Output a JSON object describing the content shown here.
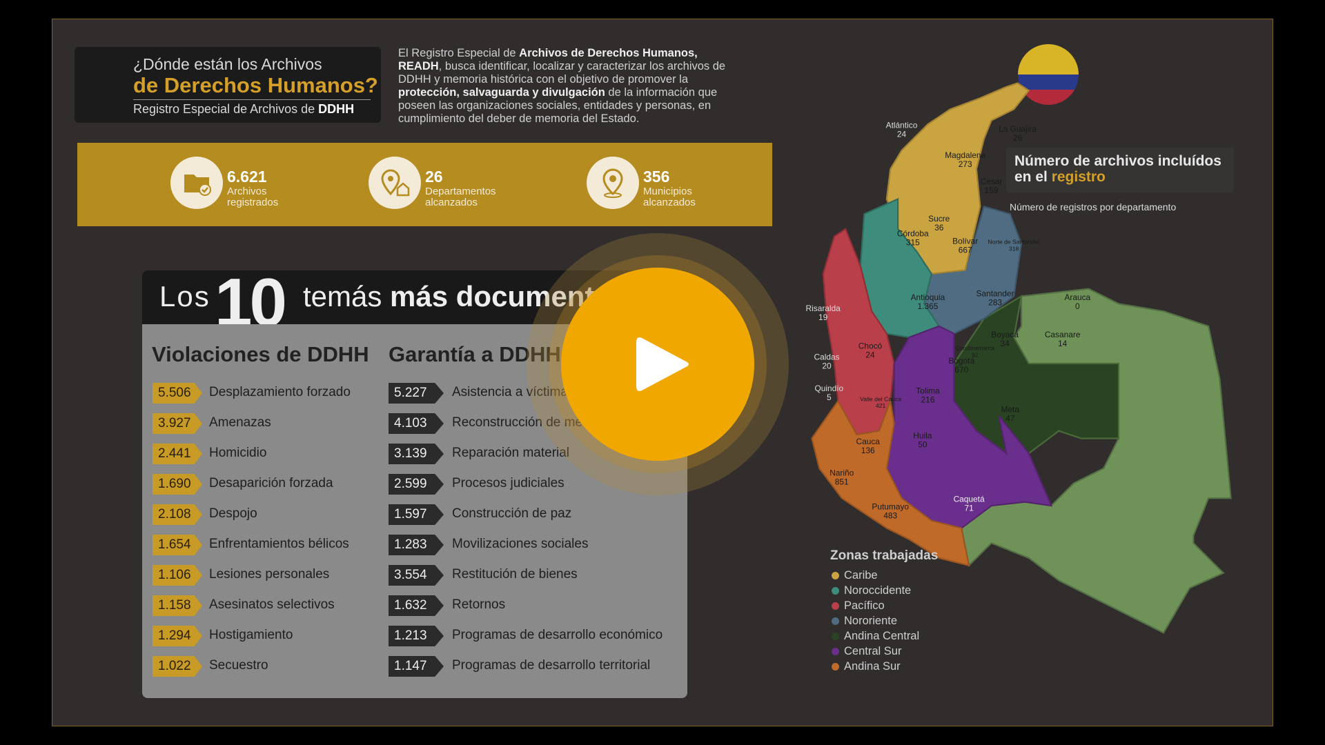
{
  "header": {
    "line1": "¿Dónde están los Archivos",
    "line2": "de Derechos Humanos?",
    "line3_prefix": "Registro Especial de Archivos de ",
    "line3_bold": "DDHH"
  },
  "intro": {
    "p1": "El Registro Especial de ",
    "b1": "Archivos de Derechos Humanos, READH",
    "p2": ", busca identificar, localizar y caracterizar los archivos de DDHH y memoria histórica con el objetivo de promover la ",
    "b2": "protección, salvaguarda y divulgación",
    "p3": " de la información que poseen las organizaciones sociales, entidades y personas, en cumplimiento del deber de memoria del Estado."
  },
  "stats": [
    {
      "value": "6.621",
      "label": "Archivos registrados",
      "icon": "folder-check-icon"
    },
    {
      "value": "26",
      "label": "Departamentos alcanzados",
      "icon": "location-home-icon"
    },
    {
      "value": "356",
      "label": "Municipios alcanzados",
      "icon": "location-pin-icon"
    }
  ],
  "top10": {
    "los": "Los",
    "ten": "10",
    "rest_plain": "temás ",
    "rest_bold": "más documentados",
    "col1_title": "Violaciones de DDHH",
    "col2_title": "Garantía a DDHH",
    "violaciones": [
      {
        "value": "5.506",
        "label": "Desplazamiento forzado"
      },
      {
        "value": "3.927",
        "label": "Amenazas"
      },
      {
        "value": "2.441",
        "label": "Homicidio"
      },
      {
        "value": "1.690",
        "label": "Desaparición forzada"
      },
      {
        "value": "2.108",
        "label": "Despojo"
      },
      {
        "value": "1.654",
        "label": "Enfrentamientos bélicos"
      },
      {
        "value": "1.106",
        "label": "Lesiones personales"
      },
      {
        "value": "1.158",
        "label": "Asesinatos selectivos"
      },
      {
        "value": "1.294",
        "label": "Hostigamiento"
      },
      {
        "value": "1.022",
        "label": "Secuestro"
      }
    ],
    "garantias": [
      {
        "value": "5.227",
        "label": "Asistencia a víctimas"
      },
      {
        "value": "4.103",
        "label": "Reconstrucción de memoria"
      },
      {
        "value": "3.139",
        "label": "Reparación material"
      },
      {
        "value": "2.599",
        "label": "Procesos judiciales"
      },
      {
        "value": "1.597",
        "label": "Construcción de paz"
      },
      {
        "value": "1.283",
        "label": "Movilizaciones sociales"
      },
      {
        "value": "3.554",
        "label": "Restitución de bienes"
      },
      {
        "value": "1.632",
        "label": "Retornos"
      },
      {
        "value": "1.213",
        "label": "Programas de desarrollo económico"
      },
      {
        "value": "1.147",
        "label": "Programas de desarrollo territorial"
      }
    ]
  },
  "map": {
    "title_plain": "Número de archivos incluídos en el ",
    "title_hl": "registro",
    "subtitle": "Número de registros por departamento",
    "departments": [
      {
        "name": "Atlántico",
        "value": "24",
        "zone": "Caribe"
      },
      {
        "name": "La Guajira",
        "value": "26",
        "zone": "Caribe"
      },
      {
        "name": "Magdalena",
        "value": "273",
        "zone": "Caribe"
      },
      {
        "name": "Cesar",
        "value": "159",
        "zone": "Caribe"
      },
      {
        "name": "Sucre",
        "value": "36",
        "zone": "Caribe"
      },
      {
        "name": "Bolívar",
        "value": "667",
        "zone": "Caribe"
      },
      {
        "name": "Córdoba",
        "value": "315",
        "zone": "Noroccidente"
      },
      {
        "name": "Norte de Santander",
        "value": "318",
        "zone": "Nororiente"
      },
      {
        "name": "Antioquia",
        "value": "1.365",
        "zone": "Noroccidente"
      },
      {
        "name": "Santander",
        "value": "283",
        "zone": "Nororiente"
      },
      {
        "name": "Arauca",
        "value": "0",
        "zone": "Andina Central"
      },
      {
        "name": "Risaralda",
        "value": "19",
        "zone": "Pacífico"
      },
      {
        "name": "Casanare",
        "value": "14",
        "zone": "Andina Central"
      },
      {
        "name": "Chocó",
        "value": "24",
        "zone": "Pacífico"
      },
      {
        "name": "Boyacá",
        "value": "34",
        "zone": "Andina Central"
      },
      {
        "name": "Cundinamarca",
        "value": "92",
        "zone": "Andina Central"
      },
      {
        "name": "Bogotá",
        "value": "670",
        "zone": "Andina Central"
      },
      {
        "name": "Caldas",
        "value": "20",
        "zone": "Pacífico"
      },
      {
        "name": "Quindío",
        "value": "5",
        "zone": "Pacífico"
      },
      {
        "name": "Valle del Cauca",
        "value": "421",
        "zone": "Pacífico"
      },
      {
        "name": "Tolima",
        "value": "216",
        "zone": "Central Sur"
      },
      {
        "name": "Meta",
        "value": "47",
        "zone": "Andina Central"
      },
      {
        "name": "Huila",
        "value": "50",
        "zone": "Central Sur"
      },
      {
        "name": "Cauca",
        "value": "136",
        "zone": "Andina Sur"
      },
      {
        "name": "Nariño",
        "value": "851",
        "zone": "Andina Sur"
      },
      {
        "name": "Putumayo",
        "value": "483",
        "zone": "Andina Sur"
      },
      {
        "name": "Caquetá",
        "value": "71",
        "zone": "Central Sur"
      }
    ]
  },
  "legend": {
    "title": "Zonas trabajadas",
    "items": [
      {
        "label": "Caribe",
        "color": "#c9a441"
      },
      {
        "label": "Noroccidente",
        "color": "#3e8c7c"
      },
      {
        "label": "Pacífico",
        "color": "#b9404a"
      },
      {
        "label": "Nororiente",
        "color": "#4f6c82"
      },
      {
        "label": "Andina Central",
        "color": "#2a4322"
      },
      {
        "label": "Central Sur",
        "color": "#6a2f8c"
      },
      {
        "label": "Andina Sur",
        "color": "#c06a2a"
      }
    ]
  },
  "colors": {
    "accent": "#d4a02a",
    "stats_bar": "#b48c1f",
    "play": "#f0a800",
    "unzoned": "#6e9257"
  }
}
